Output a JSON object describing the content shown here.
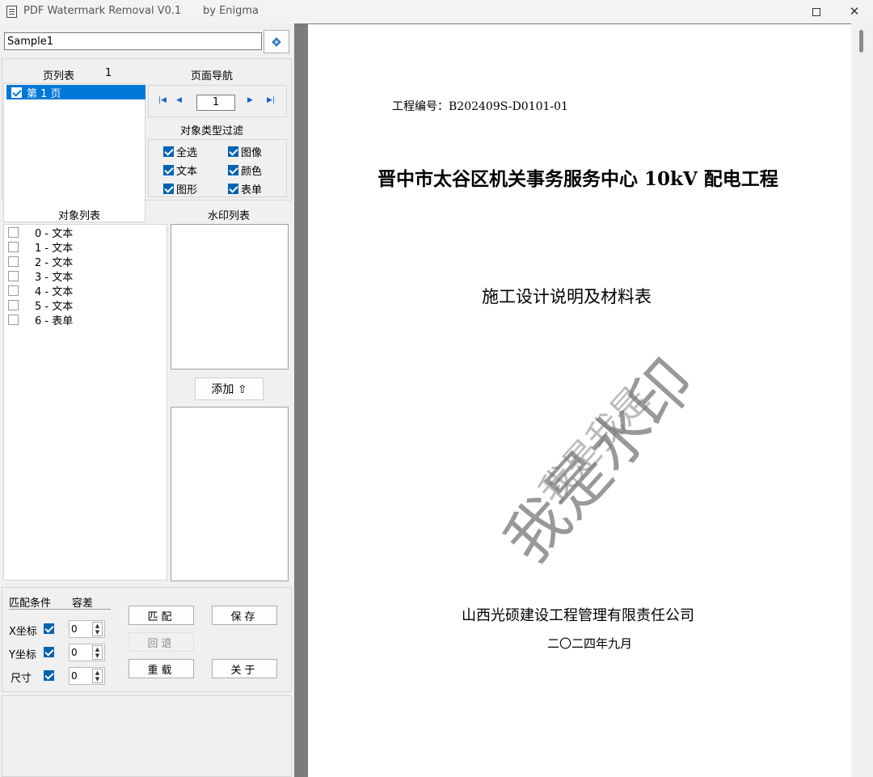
{
  "window": {
    "title": "PDF Watermark Removal   V0.1",
    "author": "by  Enigma"
  },
  "file": {
    "value": "Sample1"
  },
  "page_list": {
    "header": "页列表",
    "count": "1",
    "items": [
      {
        "label": "第 1 页",
        "checked": true
      }
    ]
  },
  "page_nav": {
    "header": "页面导航",
    "current": "1"
  },
  "filter": {
    "header": "对象类型过滤",
    "items": [
      {
        "label": "全选",
        "checked": true
      },
      {
        "label": "图像",
        "checked": true
      },
      {
        "label": "文本",
        "checked": true
      },
      {
        "label": "颜色",
        "checked": true
      },
      {
        "label": "图形",
        "checked": true
      },
      {
        "label": "表单",
        "checked": true
      }
    ]
  },
  "object_list": {
    "header": "对象列表",
    "items": [
      {
        "label": "0 - 文本"
      },
      {
        "label": "1 - 文本"
      },
      {
        "label": "2 - 文本"
      },
      {
        "label": "3 - 文本"
      },
      {
        "label": "4 - 文本"
      },
      {
        "label": "5 - 文本"
      },
      {
        "label": "6 - 表单"
      }
    ]
  },
  "watermark_list": {
    "header": "水印列表",
    "add_label": "添加 ⇧"
  },
  "match": {
    "cond_header": "匹配条件",
    "tol_header": "容差",
    "rows": [
      {
        "label": "X坐标",
        "checked": true,
        "value": "0"
      },
      {
        "label": "Y坐标",
        "checked": true,
        "value": "0"
      },
      {
        "label": "尺寸",
        "checked": true,
        "value": "0"
      }
    ],
    "buttons": {
      "match": "匹配",
      "save": "保存",
      "undo": "回退",
      "reload": "重载",
      "close": "关于"
    }
  },
  "document": {
    "project_no": "工程编号：B202409S-D0101-01",
    "title": "晋中市太谷区机关事务服务中心 10kV 配电工程",
    "subtitle": "施工设计说明及材料表",
    "company": "山西光硕建设工程管理有限责任公司",
    "date": "二〇二四年九月",
    "watermark_1": "我是水印",
    "watermark_2": "我是我是"
  }
}
